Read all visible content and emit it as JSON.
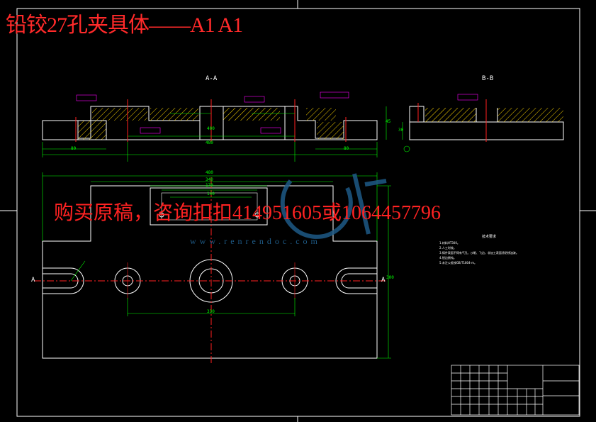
{
  "watermark": {
    "title": "铅铰27孔夹具体——A1 A1",
    "purchase": "购买原稿，咨询扣扣414951605或1064457796",
    "site": "www.renrendoc.com"
  },
  "views": {
    "section_aa": "A-A",
    "section_bb": "B-B",
    "section_marker": "A"
  },
  "colors": {
    "background": "#000000",
    "outline": "#ffffff",
    "dimension": "#00ff00",
    "centerline": "#ff2020",
    "hatch": "#ffd700",
    "annotation": "#ff00ff",
    "watermark": "#ff2222",
    "logo": "#1e5a86"
  },
  "tech_notes": {
    "heading": "技术要求",
    "lines": [
      "1.材料HT300。",
      "2.人工时效。",
      "3.铸件表面不得有气孔、沙眼、飞边，非加工表面涂防锈油漆。",
      "4.锐边倒钝。",
      "5.未注公差按GB/T1804-m。"
    ]
  },
  "dims": {
    "front_overall": "480",
    "front_left": "80",
    "front_right": "80",
    "front_center": "400",
    "plan_width": "480",
    "plan_inner": "340",
    "plan_slot": "170",
    "plan_140": "140",
    "plan_holes": "330",
    "plan_height": "300",
    "section_height": "45",
    "bb_height": "30"
  }
}
